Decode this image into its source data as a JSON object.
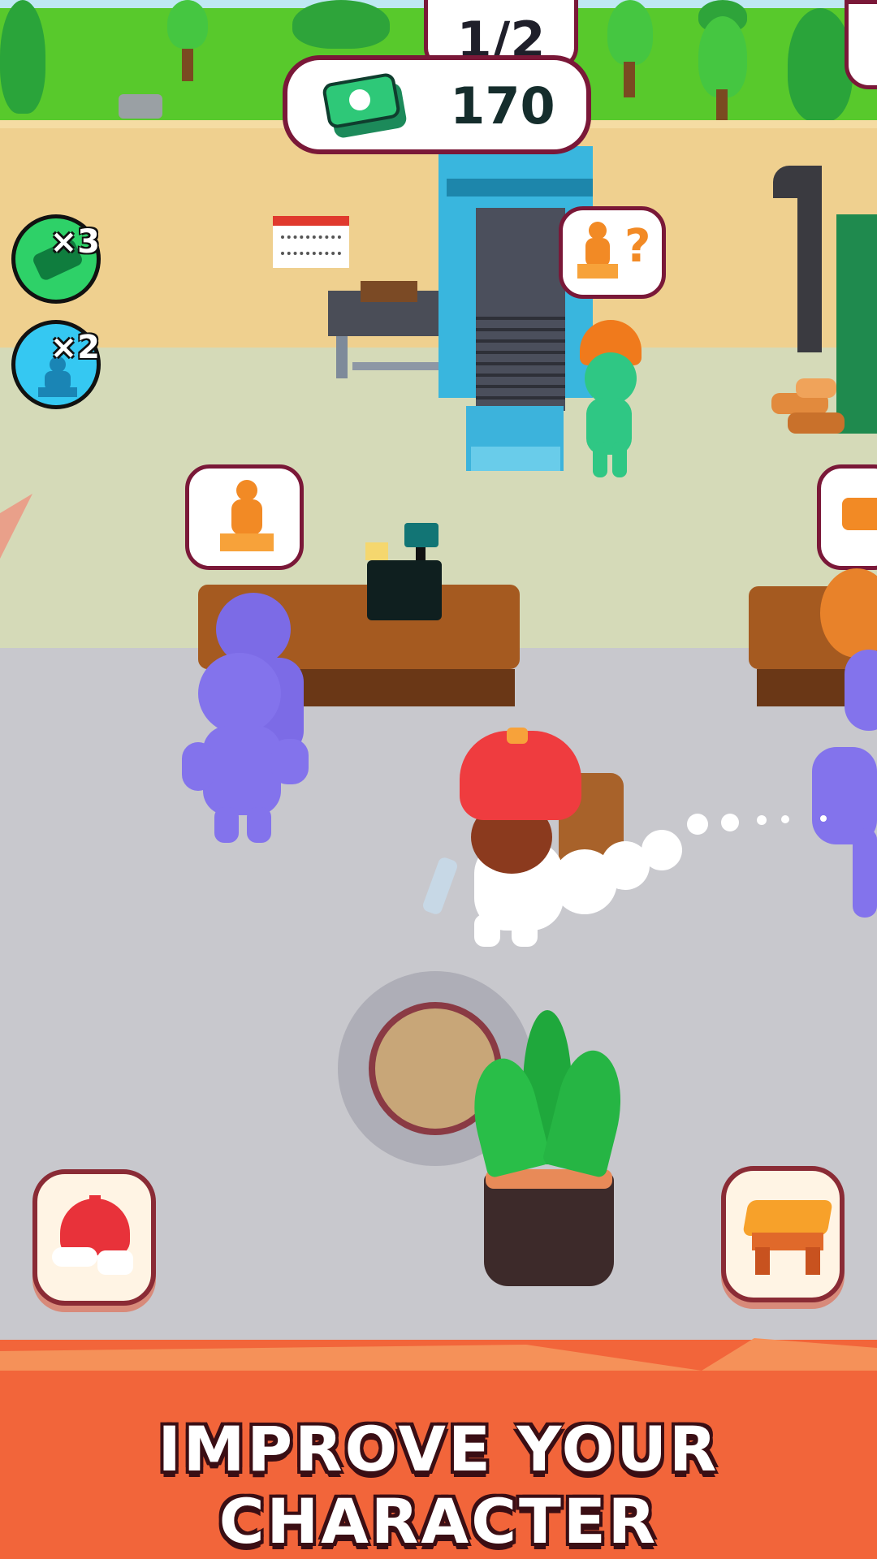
{
  "hud": {
    "level_progress": "1/2",
    "money_icon": "cash-stack-icon",
    "money_value": "170",
    "boosts": [
      {
        "name": "money-boost",
        "icon": "cash-icon",
        "label": "×3",
        "color": "#2ed168"
      },
      {
        "name": "customer-boost",
        "icon": "customer-icon",
        "label": "×2",
        "color": "#35c8f2"
      }
    ]
  },
  "scene": {
    "order_bubbles": [
      {
        "icon": "statue-icon",
        "status": "?"
      },
      {
        "icon": "statue-icon"
      },
      {
        "icon": "wood-planks-icon"
      }
    ],
    "joystick": "virtual-joystick"
  },
  "buttons": {
    "character_upgrade_icon": "red-cap-icon",
    "furniture_upgrade_icon": "stool-icon"
  },
  "banner": {
    "text": "IMPROVE YOUR CHARACTER"
  },
  "colors": {
    "outline": "#7a1838",
    "banner": "#f2653a",
    "grass": "#58c92c"
  }
}
